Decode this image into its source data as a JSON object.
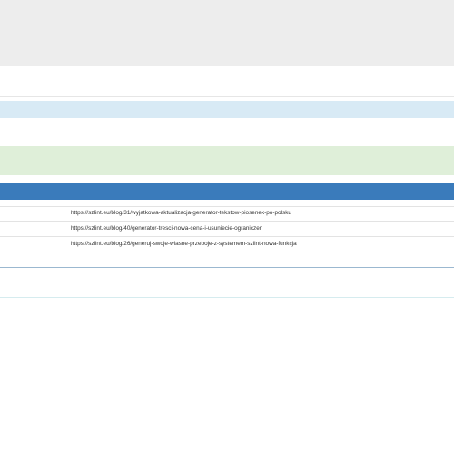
{
  "table": {
    "rows": [
      {
        "url": "https://szlint.eu/blog/31/wyjatkowa-aktualizacja-generator-tekstow-piosenek-po-polsku"
      },
      {
        "url": "https://szlint.eu/blog/40/generator-tresci-nowa-cena-i-usuniecie-ograniczen"
      },
      {
        "url": "https://szlint.eu/blog/26/generuj-swoje-wlasne-przeboje-z-systemem-szlint-nowa-funkcja"
      }
    ]
  },
  "colors": {
    "header_band": "#ededed",
    "info_bar": "#d8eaf5",
    "success_bar": "#dfefd9",
    "table_header": "#3a7bbb"
  }
}
